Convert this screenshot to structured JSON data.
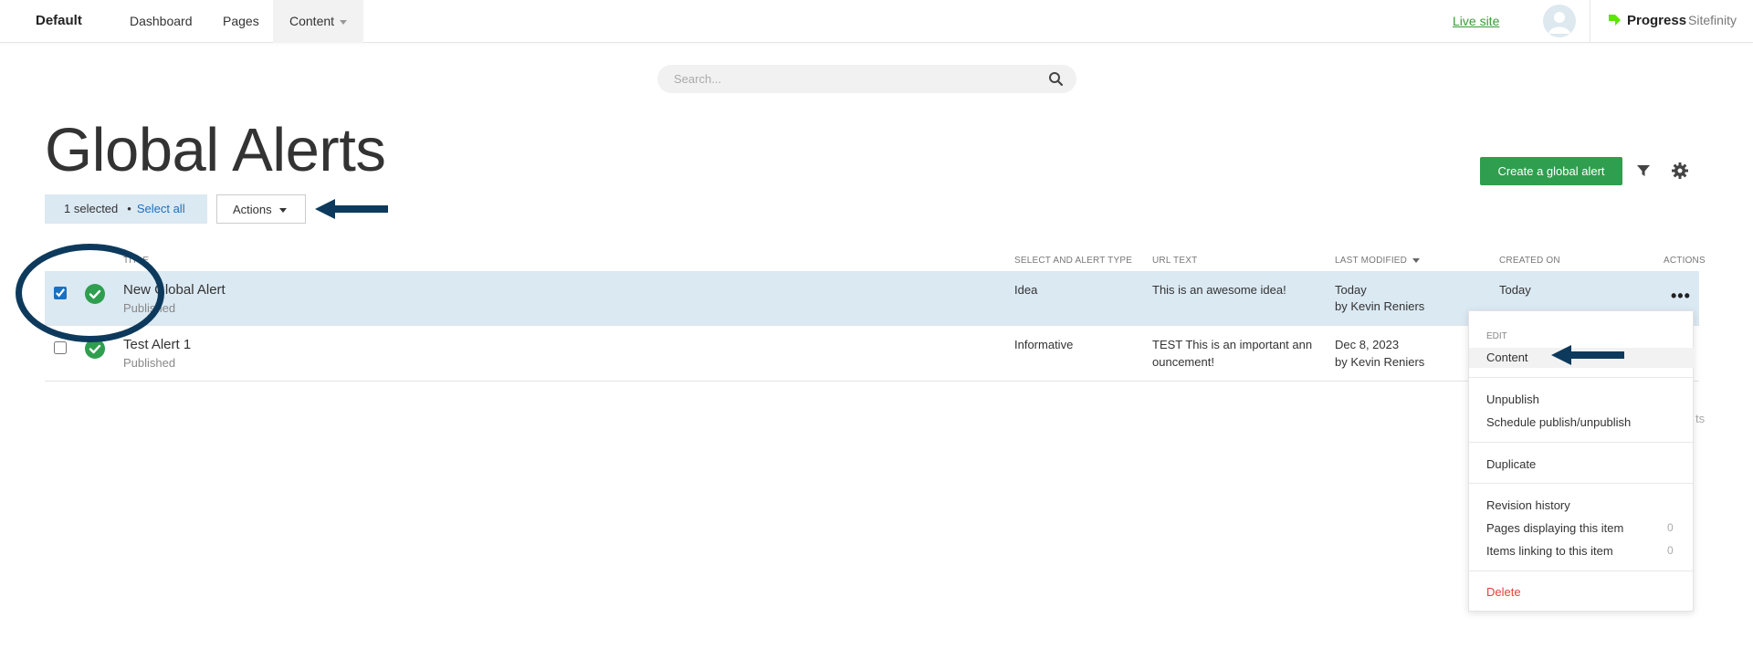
{
  "nav": {
    "brand": "Default",
    "links": [
      "Dashboard",
      "Pages",
      "Content"
    ],
    "live_site": "Live site",
    "logo_strong": "Progress",
    "logo_light": "Sitefinity"
  },
  "search": {
    "placeholder": "Search..."
  },
  "page": {
    "title": "Global Alerts",
    "selected_label": "1 selected",
    "select_all": "Select all",
    "actions_label": "Actions",
    "create_button": "Create a global alert"
  },
  "table": {
    "headers": {
      "title": "Title",
      "type": "Select and alert type",
      "url_text": "URL text",
      "last_modified": "Last modified",
      "created_on": "Created on",
      "actions": "Actions"
    },
    "rows": [
      {
        "title": "New Global Alert",
        "status": "Published",
        "type": "Idea",
        "url_text_1": "This is an awesome idea!",
        "url_text_2": "",
        "modified_1": "Today",
        "modified_2": "by Kevin Reniers",
        "created": "Today",
        "checked": true
      },
      {
        "title": "Test Alert 1",
        "status": "Published",
        "type": "Informative",
        "url_text_1": "TEST This is an important ann",
        "url_text_2": "ouncement!",
        "modified_1": "Dec 8, 2023",
        "modified_2": "by Kevin Reniers",
        "created": "",
        "checked": false
      }
    ],
    "more_label": "•••"
  },
  "menu": {
    "section_label": "EDIT",
    "items": {
      "content": "Content",
      "unpublish": "Unpublish",
      "schedule": "Schedule publish/unpublish",
      "duplicate": "Duplicate",
      "revision_history": "Revision history",
      "pages_displaying": "Pages displaying this item",
      "pages_displaying_count": "0",
      "items_linking": "Items linking to this item",
      "items_linking_count": "0",
      "delete": "Delete"
    }
  },
  "background_fragment": "ts",
  "colors": {
    "accent_green": "#2f9e4e",
    "selection_bg": "#dbe9f3",
    "link_blue": "#1a70c2",
    "annotation_navy": "#0d3a5c",
    "danger_red": "#e0433c"
  }
}
